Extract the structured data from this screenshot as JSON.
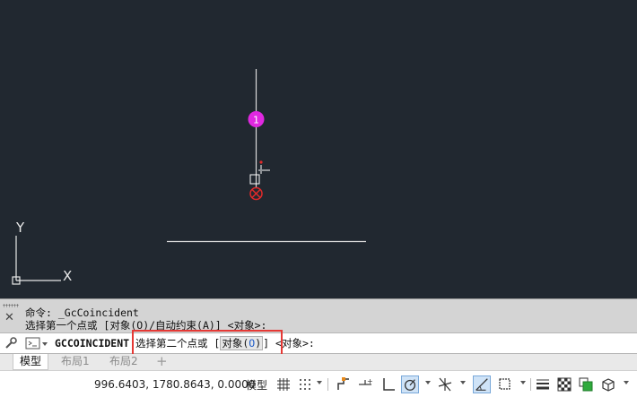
{
  "viewport": {
    "axis_y_label": "Y",
    "axis_x_label": "X",
    "constraint_marker_label": "1",
    "colors": {
      "background": "#212830",
      "geometry": "#d9d9d9",
      "marker": "#e028e0",
      "error": "#e12a2a"
    }
  },
  "command_history": {
    "line1": "命令: _GcCoincident",
    "line2": "选择第一个点或 [对象(O)/自动约束(A)] <对象>:"
  },
  "command_line": {
    "command_name": "GCCOINCIDENT",
    "prompt_prefix": "选择第二个点或 [",
    "option_label": "对象(",
    "option_key": "O",
    "option_close": ")",
    "prompt_suffix": "] <对象>:"
  },
  "layout_tabs": {
    "items": [
      {
        "label": "模型",
        "active": true
      },
      {
        "label": "布局1",
        "active": false
      },
      {
        "label": "布局2",
        "active": false
      }
    ],
    "add": "+"
  },
  "status_bar": {
    "coordinates": "996.6403, 1780.8643, 0.0000",
    "model_label": "模型",
    "icons": [
      "grid-icon",
      "snap-icon",
      "ortho-icon",
      "infer-icon",
      "isodraft-icon",
      "polar-icon",
      "osnap-tracking-icon",
      "lineweight-icon",
      "dynamic-input-icon",
      "selection-cycling-icon",
      "properties-icon",
      "transparency-icon",
      "annotation-monitor-icon",
      "3d-icon"
    ]
  }
}
